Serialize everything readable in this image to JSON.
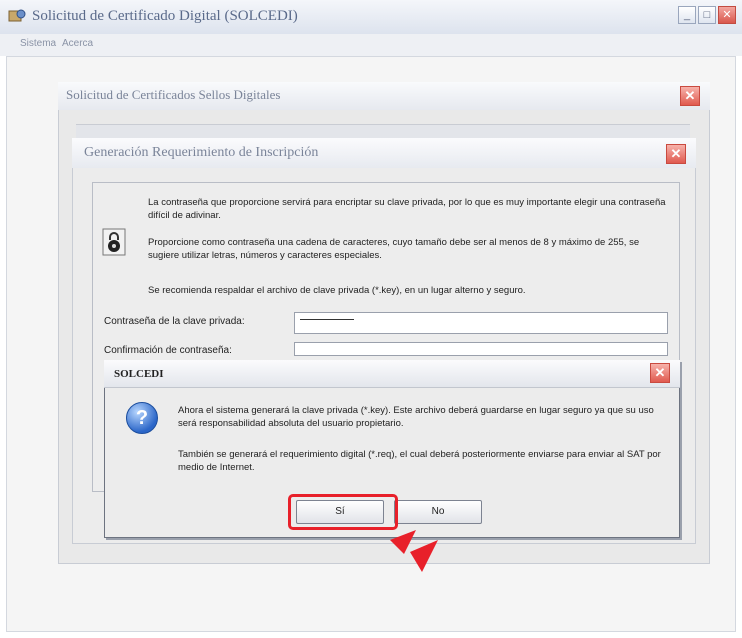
{
  "main_window": {
    "title": "Solicitud de Certificado Digital (SOLCEDI)",
    "menu": [
      "Sistema",
      "Acerca"
    ],
    "buttons": {
      "minimize": "_",
      "maximize": "□",
      "close": "✕"
    }
  },
  "dialog_sellos": {
    "title": "Solicitud de Certificados Sellos Digitales",
    "close": "✕"
  },
  "dialog_generacion": {
    "title": "Generación Requerimiento de Inscripción",
    "close": "✕",
    "info_1": "La contraseña que proporcione servirá para encriptar su clave privada, por lo que es muy importante elegir una contraseña difícil de adivinar.",
    "info_2": "Proporcione como contraseña una cadena de caracteres, cuyo tamaño debe ser al menos de 8 y máximo de 255, se sugiere utilizar letras, números y caracteres especiales.",
    "info_3": "Se recomienda respaldar el archivo de clave privada (*.key), en un lugar alterno y seguro.",
    "password_label": "Contraseña de la clave privada:",
    "confirm_label": "Confirmación de contraseña:"
  },
  "message_box": {
    "title": "SOLCEDI",
    "close": "✕",
    "icon": "question-icon",
    "text_1": "Ahora el sistema generará la clave privada (*.key). Este archivo deberá guardarse en lugar seguro ya que su uso será responsabilidad absoluta del usuario propietario.",
    "text_2": "También se generará el requerimiento digital (*.req), el cual deberá posteriormente enviarse para enviar al SAT por medio de Internet.",
    "yes_label": "Sí",
    "no_label": "No"
  },
  "colors": {
    "highlight": "#e8202a",
    "close_button": "#e05a4f",
    "question_icon": "#2b66c8"
  }
}
